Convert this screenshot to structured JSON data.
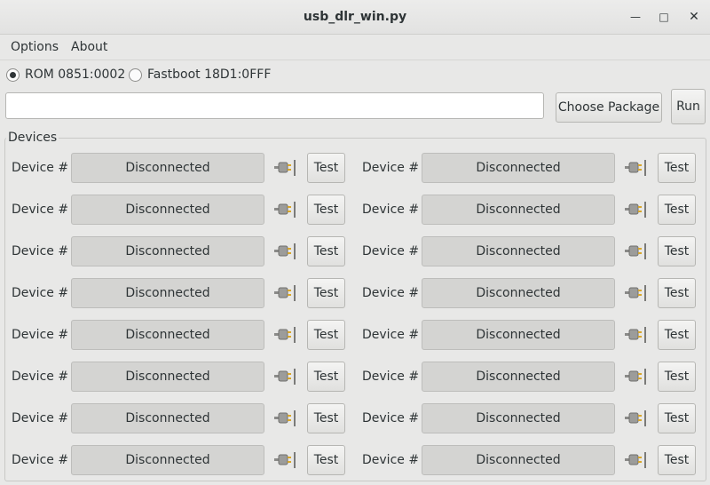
{
  "window": {
    "title": "usb_dlr_win.py",
    "min_glyph": "—",
    "max_glyph": "□",
    "close_glyph": "✕"
  },
  "menu": {
    "options": "Options",
    "about": "About"
  },
  "mode": {
    "rom_label": "ROM 0851:0002",
    "rom_checked": true,
    "fastboot_label": "Fastboot 18D1:0FFF",
    "fastboot_checked": false
  },
  "package": {
    "path_value": "",
    "choose_label": "Choose Package",
    "run_label": "Run"
  },
  "devices": {
    "group_label": "Devices",
    "device_label": "Device #",
    "status_text": "Disconnected",
    "test_label": "Test",
    "rows": 8,
    "columns": 2
  }
}
